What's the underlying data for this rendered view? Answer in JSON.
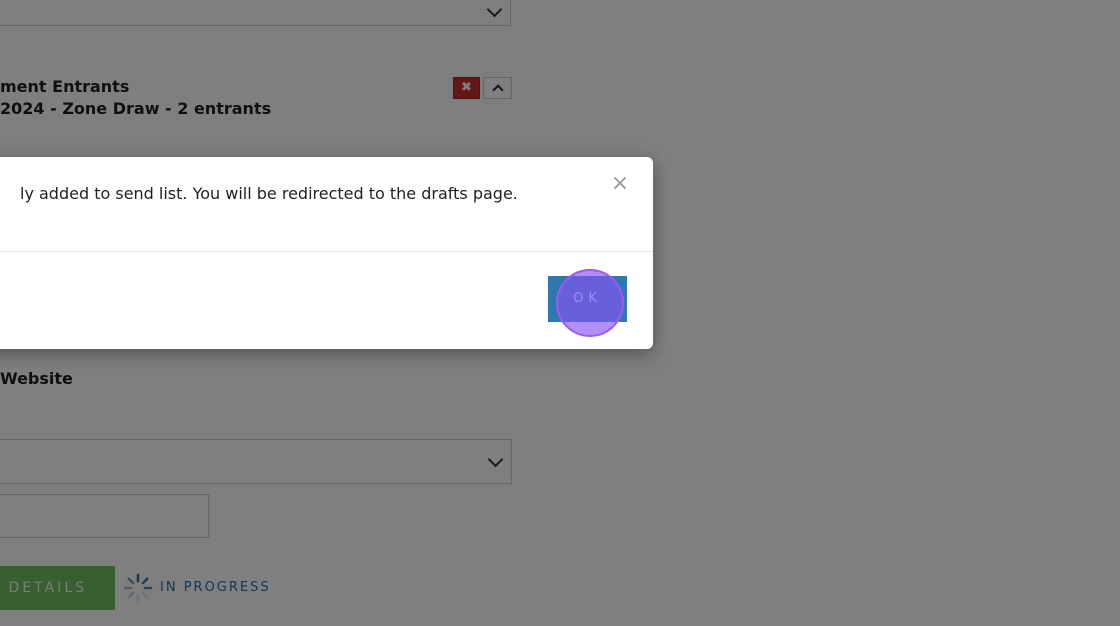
{
  "background": {
    "section_title": "ment Entrants",
    "section_subtitle": "2024 - Zone Draw - 2 entrants",
    "remove_label": "✖",
    "website_label": "Website",
    "details_button_label": "L DETAILS",
    "status_text": "IN PROGRESS"
  },
  "modal": {
    "message": "ly added to send list. You will be redirected to the drafts page.",
    "close_label": "×",
    "ok_label": "OK"
  },
  "colors": {
    "remove_button": "#c9302c",
    "ok_button": "#2f78ad",
    "details_button": "#6fbf5e",
    "status_text": "#2a6fa8",
    "click_marker": "#9c5cf3"
  },
  "icons": {
    "dropdown": "chevron-down-icon",
    "collapse": "chevron-up-icon",
    "remove": "close-icon",
    "loading": "spinner-icon"
  }
}
